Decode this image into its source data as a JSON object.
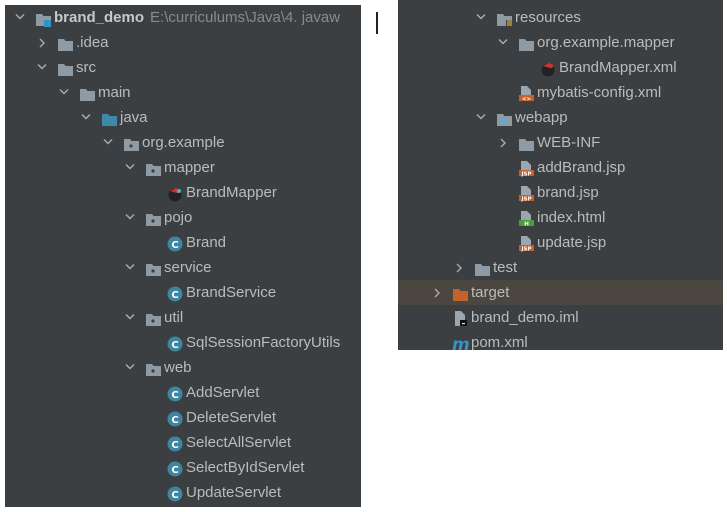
{
  "colors": {
    "panel_bg": "#3c3f41",
    "text": "#bbbbbb",
    "folder": "#8f9ba4",
    "source_folder": "#3d8aa8",
    "excluded_folder": "#c4622b",
    "class_icon": "#3e86a0",
    "jsp_icon": "#c4622b",
    "html_icon": "#4d9b3b",
    "selected_row": "#4b4740"
  },
  "left_tree": [
    {
      "depth": 0,
      "chevron": "open",
      "icon": "module-folder-icon",
      "label": "brand_demo",
      "path": "E:\\curriculums\\Java\\4. javaw",
      "bold": true
    },
    {
      "depth": 1,
      "chevron": "closed",
      "icon": "folder-icon",
      "label": ".idea"
    },
    {
      "depth": 1,
      "chevron": "open",
      "icon": "folder-icon",
      "label": "src"
    },
    {
      "depth": 2,
      "chevron": "open",
      "icon": "folder-icon",
      "label": "main"
    },
    {
      "depth": 3,
      "chevron": "open",
      "icon": "source-folder-icon",
      "label": "java"
    },
    {
      "depth": 4,
      "chevron": "open",
      "icon": "package-icon",
      "label": "org.example"
    },
    {
      "depth": 5,
      "chevron": "open",
      "icon": "package-icon",
      "label": "mapper"
    },
    {
      "depth": 6,
      "chevron": "none",
      "icon": "mybatis-mapper-icon",
      "label": "BrandMapper"
    },
    {
      "depth": 5,
      "chevron": "open",
      "icon": "package-icon",
      "label": "pojo"
    },
    {
      "depth": 6,
      "chevron": "none",
      "icon": "class-icon",
      "label": "Brand"
    },
    {
      "depth": 5,
      "chevron": "open",
      "icon": "package-icon",
      "label": "service"
    },
    {
      "depth": 6,
      "chevron": "none",
      "icon": "class-icon",
      "label": "BrandService"
    },
    {
      "depth": 5,
      "chevron": "open",
      "icon": "package-icon",
      "label": "util"
    },
    {
      "depth": 6,
      "chevron": "none",
      "icon": "class-icon",
      "label": "SqlSessionFactoryUtils"
    },
    {
      "depth": 5,
      "chevron": "open",
      "icon": "package-icon",
      "label": "web"
    },
    {
      "depth": 6,
      "chevron": "none",
      "icon": "class-icon",
      "label": "AddServlet"
    },
    {
      "depth": 6,
      "chevron": "none",
      "icon": "class-icon",
      "label": "DeleteServlet"
    },
    {
      "depth": 6,
      "chevron": "none",
      "icon": "class-icon",
      "label": "SelectAllServlet"
    },
    {
      "depth": 6,
      "chevron": "none",
      "icon": "class-icon",
      "label": "SelectByIdServlet"
    },
    {
      "depth": 6,
      "chevron": "none",
      "icon": "class-icon",
      "label": "UpdateServlet"
    }
  ],
  "right_tree": [
    {
      "depth": 3,
      "chevron": "open",
      "icon": "resources-folder-icon",
      "label": "resources"
    },
    {
      "depth": 4,
      "chevron": "open",
      "icon": "folder-icon",
      "label": "org.example.mapper"
    },
    {
      "depth": 5,
      "chevron": "none",
      "icon": "mybatis-xml-icon",
      "label": "BrandMapper.xml"
    },
    {
      "depth": 4,
      "chevron": "none",
      "icon": "xml-file-icon",
      "label": "mybatis-config.xml"
    },
    {
      "depth": 3,
      "chevron": "open",
      "icon": "web-folder-icon",
      "label": "webapp"
    },
    {
      "depth": 4,
      "chevron": "closed",
      "icon": "folder-icon",
      "label": "WEB-INF"
    },
    {
      "depth": 4,
      "chevron": "none",
      "icon": "jsp-file-icon",
      "label": "addBrand.jsp"
    },
    {
      "depth": 4,
      "chevron": "none",
      "icon": "jsp-file-icon",
      "label": "brand.jsp"
    },
    {
      "depth": 4,
      "chevron": "none",
      "icon": "html-file-icon",
      "label": "index.html"
    },
    {
      "depth": 4,
      "chevron": "none",
      "icon": "jsp-file-icon",
      "label": "update.jsp"
    },
    {
      "depth": 2,
      "chevron": "closed",
      "icon": "folder-icon",
      "label": "test"
    },
    {
      "depth": 1,
      "chevron": "closed",
      "icon": "excluded-folder-icon",
      "label": "target",
      "selected": true
    },
    {
      "depth": 1,
      "chevron": "none",
      "icon": "iml-file-icon",
      "label": "brand_demo.iml"
    },
    {
      "depth": 1,
      "chevron": "none",
      "icon": "maven-pom-icon",
      "label": "pom.xml"
    }
  ]
}
